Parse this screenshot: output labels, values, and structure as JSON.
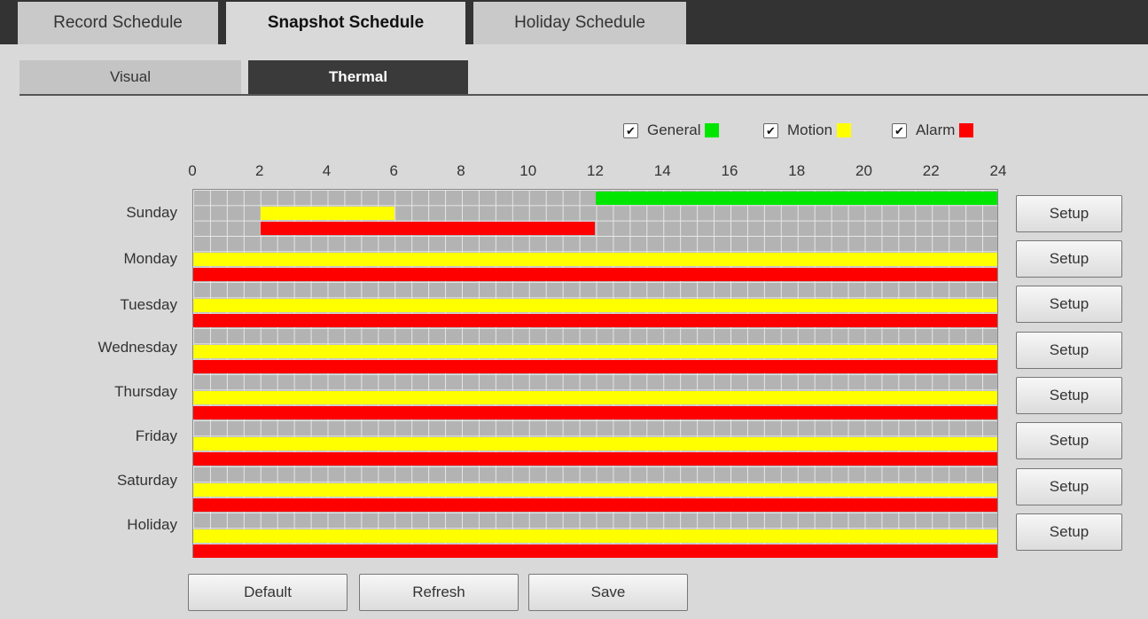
{
  "tabs": {
    "record": "Record Schedule",
    "snapshot": "Snapshot Schedule",
    "holiday": "Holiday Schedule"
  },
  "subtabs": {
    "visual": "Visual",
    "thermal": "Thermal"
  },
  "legend": [
    {
      "label": "General",
      "checked": true,
      "color": "#00e600"
    },
    {
      "label": "Motion",
      "checked": true,
      "color": "#ffff00"
    },
    {
      "label": "Alarm",
      "checked": true,
      "color": "#ff0000"
    }
  ],
  "hours": [
    "0",
    "2",
    "4",
    "6",
    "8",
    "10",
    "12",
    "14",
    "16",
    "18",
    "20",
    "22",
    "24"
  ],
  "days": [
    {
      "label": "Sunday",
      "setup": "Setup",
      "periods": [
        {
          "type": "General",
          "start": 12,
          "end": 24
        },
        {
          "type": "Motion",
          "start": 2,
          "end": 6
        },
        {
          "type": "Alarm",
          "start": 2,
          "end": 12
        }
      ]
    },
    {
      "label": "Monday",
      "setup": "Setup",
      "periods": [
        {
          "type": "Motion",
          "start": 0,
          "end": 24
        },
        {
          "type": "Alarm",
          "start": 0,
          "end": 24
        }
      ]
    },
    {
      "label": "Tuesday",
      "setup": "Setup",
      "periods": [
        {
          "type": "Motion",
          "start": 0,
          "end": 24
        },
        {
          "type": "Alarm",
          "start": 0,
          "end": 24
        }
      ]
    },
    {
      "label": "Wednesday",
      "setup": "Setup",
      "periods": [
        {
          "type": "Motion",
          "start": 0,
          "end": 24
        },
        {
          "type": "Alarm",
          "start": 0,
          "end": 24
        }
      ]
    },
    {
      "label": "Thursday",
      "setup": "Setup",
      "periods": [
        {
          "type": "Motion",
          "start": 0,
          "end": 24
        },
        {
          "type": "Alarm",
          "start": 0,
          "end": 24
        }
      ]
    },
    {
      "label": "Friday",
      "setup": "Setup",
      "periods": [
        {
          "type": "Motion",
          "start": 0,
          "end": 24
        },
        {
          "type": "Alarm",
          "start": 0,
          "end": 24
        }
      ]
    },
    {
      "label": "Saturday",
      "setup": "Setup",
      "periods": [
        {
          "type": "Motion",
          "start": 0,
          "end": 24
        },
        {
          "type": "Alarm",
          "start": 0,
          "end": 24
        }
      ]
    },
    {
      "label": "Holiday",
      "setup": "Setup",
      "periods": [
        {
          "type": "Motion",
          "start": 0,
          "end": 24
        },
        {
          "type": "Alarm",
          "start": 0,
          "end": 24
        }
      ]
    }
  ],
  "buttons": {
    "default": "Default",
    "refresh": "Refresh",
    "save": "Save"
  }
}
